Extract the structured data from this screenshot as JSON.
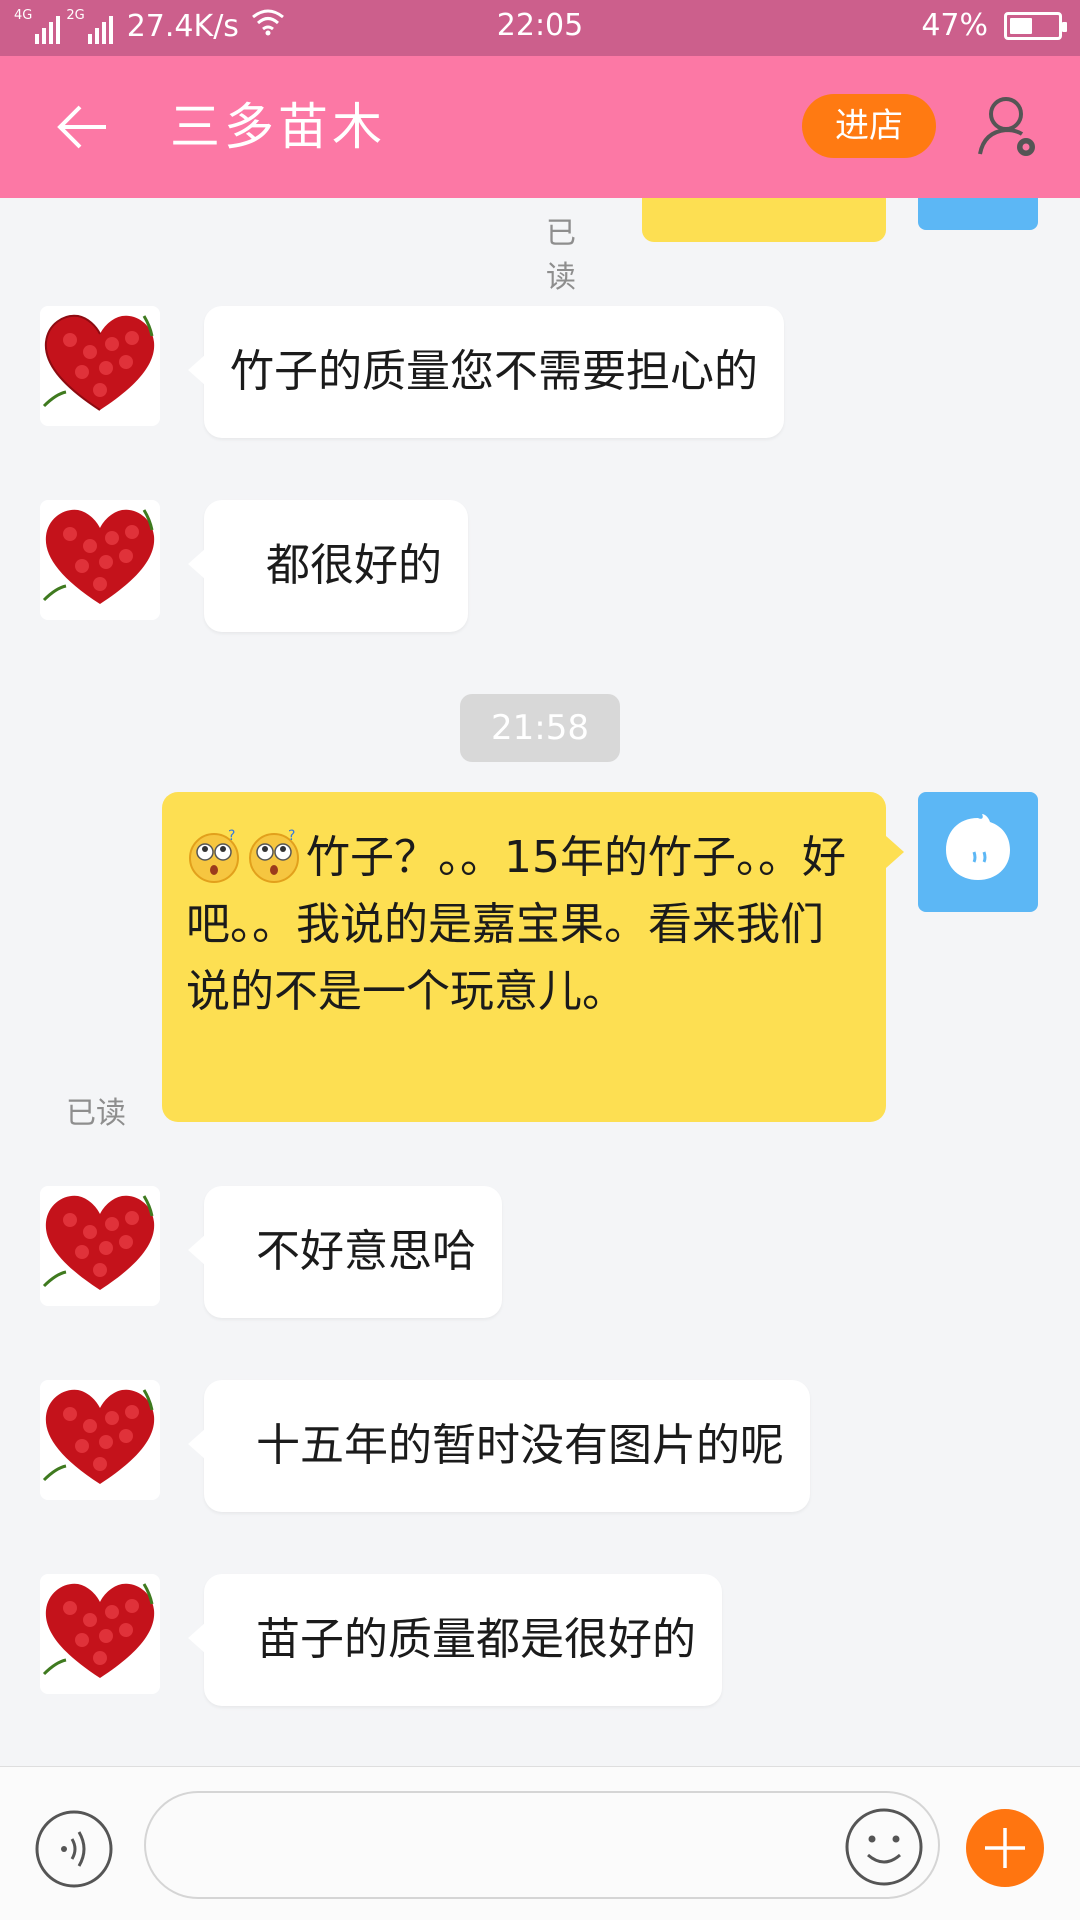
{
  "status_bar": {
    "network_a": "4G",
    "network_b": "2G",
    "speed": "27.4K/s",
    "time": "22:05",
    "battery": "47%",
    "battery_level": 0.47,
    "background_color": "#cc5f8c"
  },
  "header": {
    "title": "三多苗木",
    "shop_button": "进店",
    "back_icon": "arrow-left-icon",
    "user_icon": "user-settings-icon",
    "background_color": "#fc78a5",
    "shop_button_color": "#ff7a12"
  },
  "chat": {
    "read_label": "已读",
    "time_divider": "21:58",
    "messages": [
      {
        "from": "shop",
        "text": "竹子的质量您不需要担心的"
      },
      {
        "from": "shop",
        "text": "都很好的"
      },
      {
        "from": "me",
        "text": "竹子？。。15年的竹子。。好吧。。我说的是嘉宝果。看来我们说的不是一个玩意儿。",
        "emoji": "confused-face-emoji",
        "emoji_count": 2
      },
      {
        "from": "shop",
        "text": "不好意思哈"
      },
      {
        "from": "shop",
        "text": "十五年的暂时没有图片的呢"
      },
      {
        "from": "shop",
        "text": "苗子的质量都是很好的"
      }
    ],
    "shop_avatar": "red-rose-heart-avatar",
    "my_avatar": "blue-bubble-avatar",
    "incoming_bubble_color": "#ffffff",
    "outgoing_bubble_color": "#fddf52"
  },
  "input_bar": {
    "message_value": "",
    "voice_icon": "voice-icon",
    "emoji_icon": "smiley-icon",
    "plus_icon": "plus-icon",
    "plus_color": "#ff7510"
  }
}
